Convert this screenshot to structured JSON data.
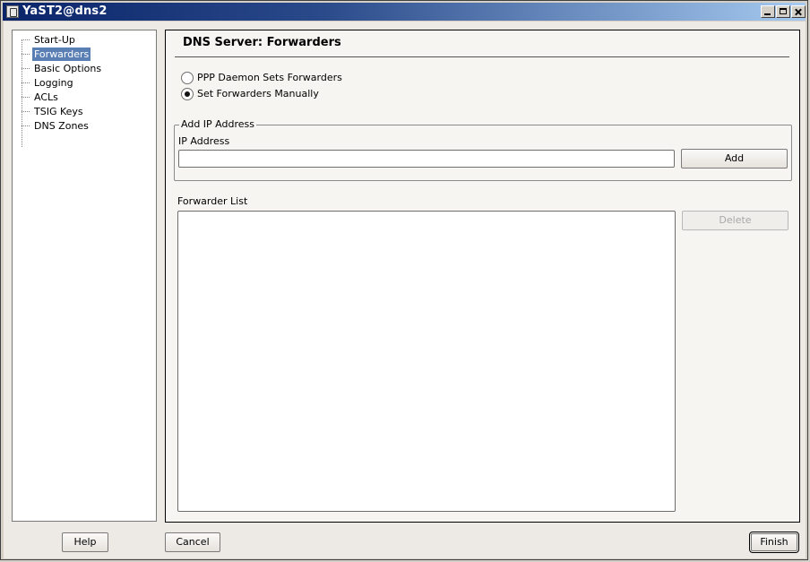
{
  "window": {
    "title": "YaST2@dns2",
    "controls": {
      "minimize": "minimize-icon",
      "maximize": "maximize-icon",
      "close": "close-icon"
    }
  },
  "tree": {
    "items": [
      {
        "label": "Start-Up",
        "selected": false
      },
      {
        "label": "Forwarders",
        "selected": true
      },
      {
        "label": "Basic Options",
        "selected": false
      },
      {
        "label": "Logging",
        "selected": false
      },
      {
        "label": "ACLs",
        "selected": false
      },
      {
        "label": "TSIG Keys",
        "selected": false
      },
      {
        "label": "DNS Zones",
        "selected": false
      }
    ]
  },
  "main": {
    "title": "DNS Server: Forwarders",
    "radios": [
      {
        "label": "PPP Daemon Sets Forwarders",
        "checked": false
      },
      {
        "label": "Set Forwarders Manually",
        "checked": true
      }
    ],
    "add_group": {
      "legend": "Add IP Address",
      "ip_label": "IP Address",
      "ip_value": "",
      "add_button": "Add"
    },
    "forwarder_list": {
      "label": "Forwarder List",
      "items": [],
      "delete_button": "Delete"
    }
  },
  "footer": {
    "help": "Help",
    "cancel": "Cancel",
    "finish": "Finish"
  },
  "colors": {
    "title_gradient_start": "#0a246a",
    "selection": "#5a7fb5",
    "panel_bg": "#f7f5f1"
  }
}
